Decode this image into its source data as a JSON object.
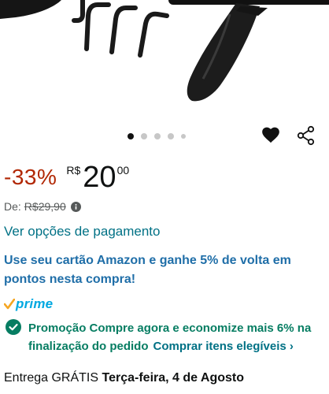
{
  "carousel": {
    "total": 5,
    "active_index": 0
  },
  "actions": {
    "favorite_icon": "heart-icon",
    "share_icon": "share-icon"
  },
  "price": {
    "discount": "-33%",
    "currency": "R$",
    "whole": "20",
    "fraction": "00",
    "list_label": "De:",
    "list_price": "R$29,90",
    "info_icon": "info-icon"
  },
  "payment": {
    "link": "Ver opções de pagamento"
  },
  "card_promo": {
    "text": "Use seu cartão Amazon e ganhe 5% de volta em pontos nesta compra!"
  },
  "prime": {
    "label": "prime",
    "check_color": "#f5a623",
    "text_color": "#00a8e1"
  },
  "promotion": {
    "text": "Promoção Compre agora e economize mais 6% na finalização do pedido",
    "link": "Comprar itens elegíveis",
    "link_chevron": "›",
    "icon": "check-circle-icon",
    "color": "#067d62"
  },
  "delivery": {
    "prefix": "Entrega GRÁTIS",
    "date": "Terça-feira, 4 de Agosto"
  },
  "colors": {
    "discount": "#b12704",
    "link": "#007185",
    "card_promo": "#1f6ea8"
  }
}
